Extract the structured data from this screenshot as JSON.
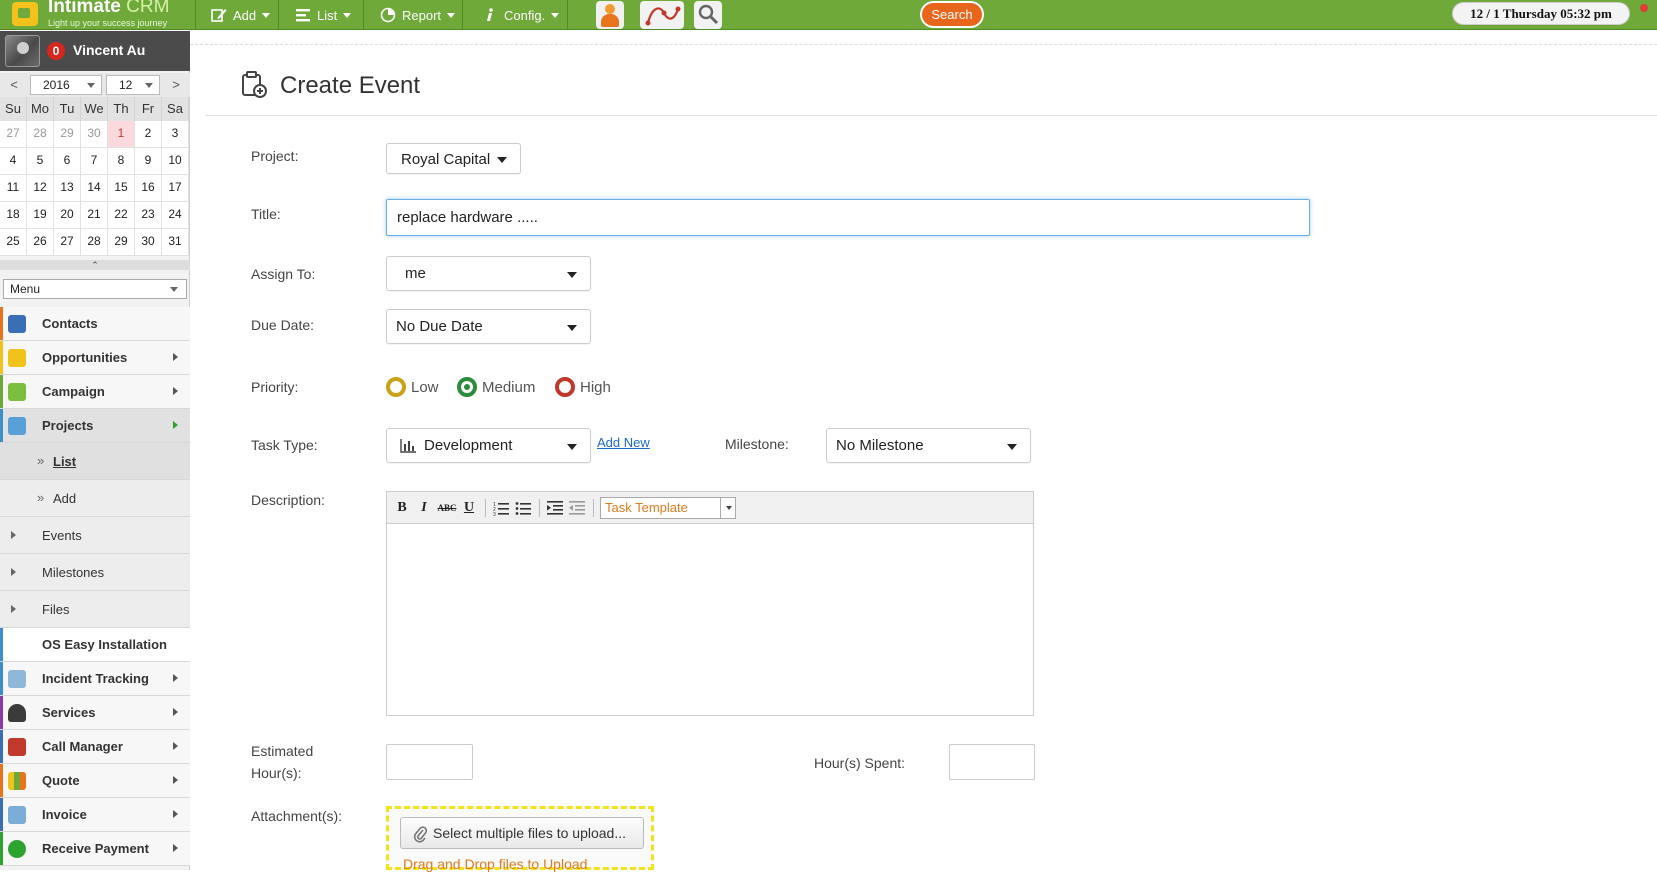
{
  "app": {
    "brand_name": "Intimate",
    "brand_suffix": "CRM",
    "tagline": "Light up your success journey"
  },
  "topnav": {
    "add_label": "Add",
    "list_label": "List",
    "report_label": "Report",
    "config_label": "Config.",
    "search_label": "Search",
    "datetime": "12 / 1  Thursday  05:32 pm"
  },
  "user": {
    "badge_count": "0",
    "name": "Vincent Au"
  },
  "calendar": {
    "year": "2016",
    "month": "12",
    "prev_label": "<",
    "next_label": ">",
    "weekdays": [
      "Su",
      "Mo",
      "Tu",
      "We",
      "Th",
      "Fr",
      "Sa"
    ],
    "days": [
      "27",
      "28",
      "29",
      "30",
      "1",
      "2",
      "3",
      "4",
      "5",
      "6",
      "7",
      "8",
      "9",
      "10",
      "11",
      "12",
      "13",
      "14",
      "15",
      "16",
      "17",
      "18",
      "19",
      "20",
      "21",
      "22",
      "23",
      "24",
      "25",
      "26",
      "27",
      "28",
      "29",
      "30",
      "31"
    ],
    "today": "1",
    "collapse_label": "⌃"
  },
  "menu": {
    "select_label": "Menu",
    "items": [
      {
        "label": "Contacts"
      },
      {
        "label": "Opportunities"
      },
      {
        "label": "Campaign"
      },
      {
        "label": "Projects"
      },
      {
        "label": "List"
      },
      {
        "label": "Add"
      },
      {
        "label": "Events"
      },
      {
        "label": "Milestones"
      },
      {
        "label": "Files"
      },
      {
        "label": "OS Easy Installation"
      },
      {
        "label": "Incident Tracking"
      },
      {
        "label": "Services"
      },
      {
        "label": "Call Manager"
      },
      {
        "label": "Quote"
      },
      {
        "label": "Invoice"
      },
      {
        "label": "Receive Payment"
      }
    ],
    "sub_marker": "»"
  },
  "form": {
    "page_title": "Create Event",
    "project_label": "Project:",
    "project_value": "Royal Capital",
    "title_label": "Title:",
    "title_value": "replace hardware .....",
    "assign_label": "Assign To:",
    "assign_value": "me",
    "due_label": "Due Date:",
    "due_value": "No Due Date",
    "priority_label": "Priority:",
    "priority_options": [
      "Low",
      "Medium",
      "High"
    ],
    "priority_selected": "Medium",
    "task_type_label": "Task Type:",
    "task_type_value": "Development",
    "add_new_label": "Add New",
    "milestone_label": "Milestone:",
    "milestone_value": "No Milestone",
    "description_label": "Description:",
    "editor": {
      "bold": "B",
      "italic": "I",
      "strike": "ABC",
      "underline": "U",
      "template_label": "Task Template"
    },
    "est_hours_label_1": "Estimated",
    "est_hours_label_2": "Hour(s):",
    "hours_spent_label": "Hour(s) Spent:",
    "attachments_label": "Attachment(s):",
    "upload_button": "Select multiple files to upload...",
    "drop_text": "Drag and Drop files to Upload"
  },
  "colors": {
    "topbar": "#6ea93a",
    "search": "#e8661c",
    "priority_low": "#c9a21a",
    "priority_medium": "#2b8c3b",
    "priority_high": "#c0392b",
    "link": "#1a6bc4",
    "template_text": "#e07b1c",
    "dropzone_border": "#f2e31a"
  }
}
